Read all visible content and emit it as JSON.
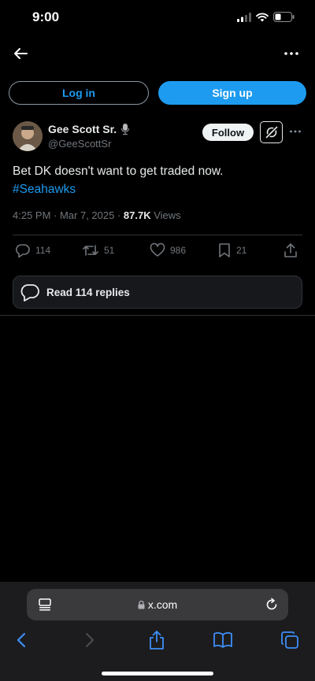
{
  "status_bar": {
    "time": "9:00"
  },
  "auth": {
    "login_label": "Log in",
    "signup_label": "Sign up"
  },
  "tweet": {
    "author_name": "Gee Scott Sr.",
    "author_handle": "@GeeScottSr",
    "follow_label": "Follow",
    "text": "Bet DK doesn't want to get traded now.",
    "hashtag": "#Seahawks",
    "timestamp": "4:25 PM · Mar 7, 2025 · ",
    "views_count": "87.7K",
    "views_label": " Views"
  },
  "actions": {
    "replies": "114",
    "reposts": "51",
    "likes": "986",
    "bookmarks": "21"
  },
  "read_replies_label": "Read 114 replies",
  "browser": {
    "url": "x.com"
  },
  "colors": {
    "accent": "#1d9bf0",
    "background": "#000000",
    "muted": "#71767b"
  },
  "icons": [
    "back-arrow-icon",
    "more-icon",
    "microphone-icon",
    "grok-icon",
    "reply-icon",
    "repost-icon",
    "like-icon",
    "bookmark-icon",
    "share-icon",
    "speech-bubbles-icon",
    "lock-icon",
    "reload-icon"
  ]
}
